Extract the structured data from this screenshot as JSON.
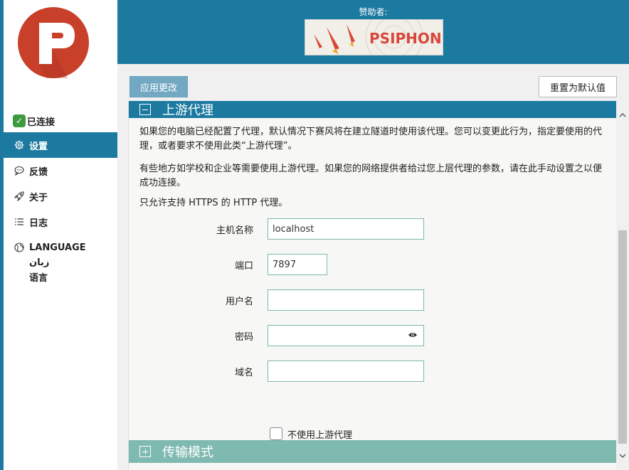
{
  "sidebar": {
    "status": "已连接",
    "items": [
      {
        "label": "设置",
        "icon": "gear-icon"
      },
      {
        "label": "反馈",
        "icon": "chat-icon"
      },
      {
        "label": "关于",
        "icon": "rocket-icon"
      },
      {
        "label": "日志",
        "icon": "list-icon"
      },
      {
        "label": "LANGUAGE",
        "icon": "globe-icon"
      }
    ],
    "lang_sub": [
      "زبان",
      "语言"
    ]
  },
  "header": {
    "sponsor_label": "赞助者:",
    "banner_text": "PSIPHON"
  },
  "toolbar": {
    "apply_label": "应用更改",
    "reset_label": "重置为默认值"
  },
  "section": {
    "title": "上游代理",
    "para1": "如果您的电脑已经配置了代理，默认情况下赛风将在建立隧道时使用该代理。您可以变更此行为，指定要使用的代理，或者要求不使用此类“上游代理”。",
    "para2": "有些地方如学校和企业等需要使用上游代理。如果您的网络提供者给过您上层代理的参数，请在此手动设置之以便成功连接。",
    "para3": "只允许支持 HTTPS 的 HTTP 代理。"
  },
  "form": {
    "host_label": "主机名称",
    "host_value": "localhost",
    "port_label": "端口",
    "port_value": "7897",
    "user_label": "用户名",
    "user_value": "",
    "pass_label": "密码",
    "pass_value": "",
    "domain_label": "域名",
    "domain_value": "",
    "no_upstream_label": "不使用上游代理"
  },
  "section2": {
    "title": "传输模式"
  },
  "colors": {
    "primary": "#1c7aa0",
    "accent_teal": "#7fbab0",
    "logo_red": "#c8402a",
    "connected_green": "#3c9b3c"
  }
}
